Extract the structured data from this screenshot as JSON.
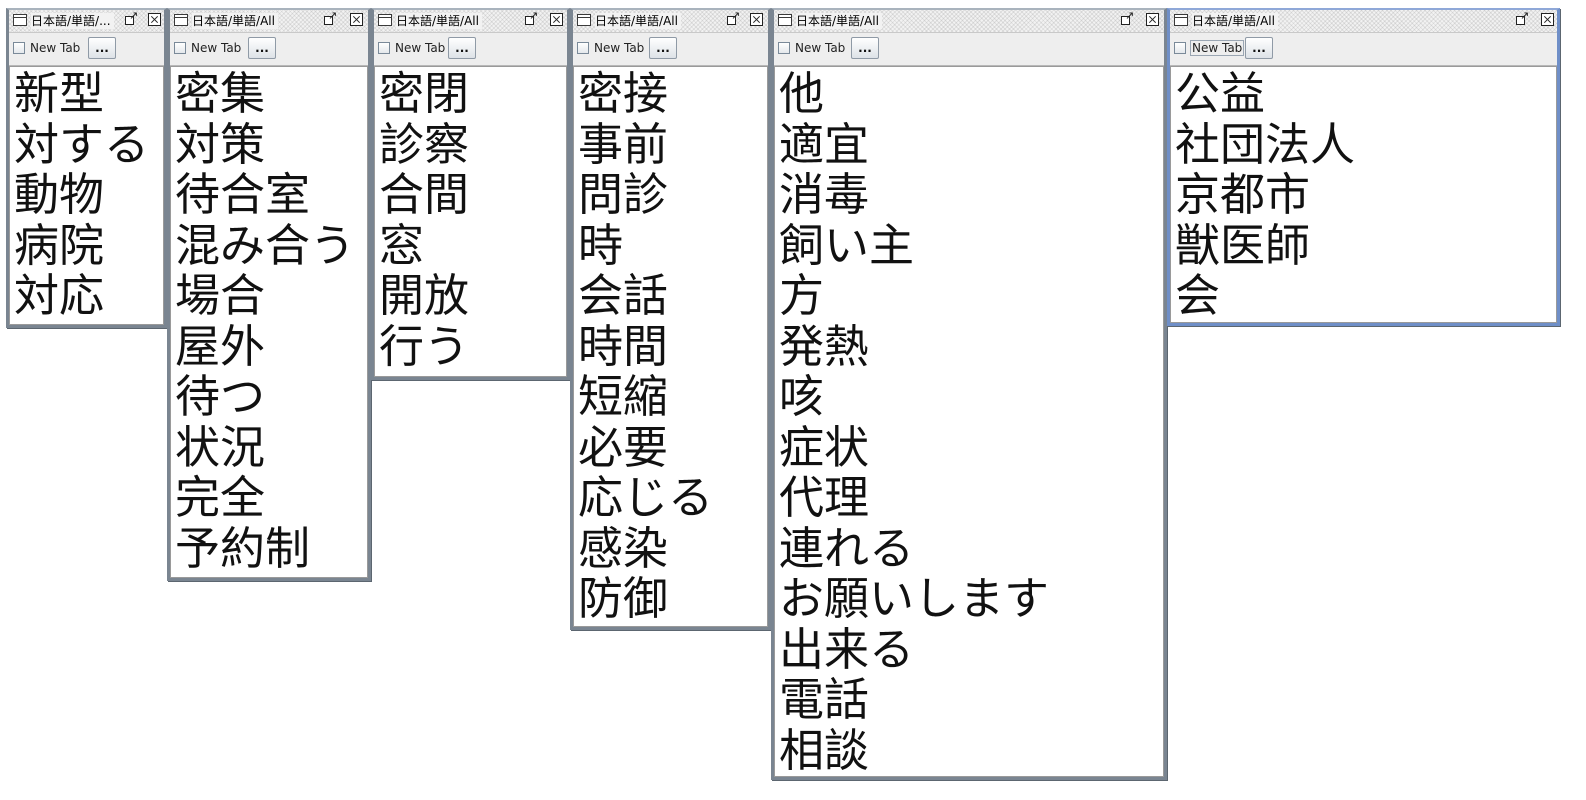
{
  "panels": [
    {
      "title": "日本語/単語/...",
      "tab_label": "New Tab",
      "more_label": "...",
      "words": [
        "新型",
        "対する",
        "動物",
        "病院",
        "対応"
      ]
    },
    {
      "title": "日本語/単語/All",
      "tab_label": "New Tab",
      "more_label": "...",
      "words": [
        "密集",
        "対策",
        "待合室",
        "混み合う",
        "場合",
        "屋外",
        "待つ",
        "状況",
        "完全",
        "予約制"
      ]
    },
    {
      "title": "日本語/単語/All",
      "tab_label": "New Tab",
      "more_label": "...",
      "words": [
        "密閉",
        "診察",
        "合間",
        "窓",
        "開放",
        "行う"
      ]
    },
    {
      "title": "日本語/単語/All",
      "tab_label": "New Tab",
      "more_label": "...",
      "words": [
        "密接",
        "事前",
        "問診",
        "時",
        "会話",
        "時間",
        "短縮",
        "必要",
        "応じる",
        "感染",
        "防御"
      ]
    },
    {
      "title": "日本語/単語/All",
      "tab_label": "New Tab",
      "more_label": "...",
      "words": [
        "他",
        "適宜",
        "消毒",
        "飼い主",
        "方",
        "発熱",
        "咳",
        "症状",
        "代理",
        "連れる",
        "お願いします",
        "出来る",
        "電話",
        "相談"
      ]
    },
    {
      "title": "日本語/単語/All",
      "tab_label": "New Tab",
      "more_label": "...",
      "words": [
        "公益",
        "社団法人",
        "京都市",
        "獣医師",
        "会"
      ]
    }
  ]
}
